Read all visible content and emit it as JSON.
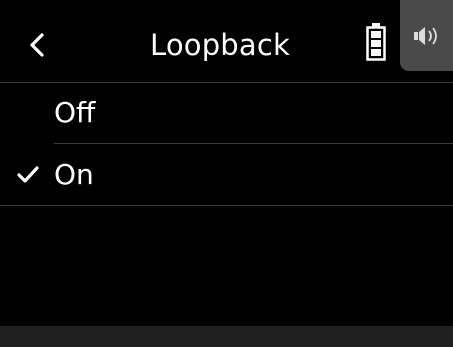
{
  "header": {
    "title": "Loopback",
    "back_icon": "chevron-left-icon",
    "battery_icon": "battery-icon",
    "speaker_icon": "speaker-icon"
  },
  "options": [
    {
      "label": "Off",
      "selected": false
    },
    {
      "label": "On",
      "selected": true
    }
  ],
  "colors": {
    "background": "#000000",
    "text": "#ffffff",
    "divider": "#3a3a3a",
    "speaker_tab": "#4a4a4a",
    "bottom_bar": "#202020"
  }
}
